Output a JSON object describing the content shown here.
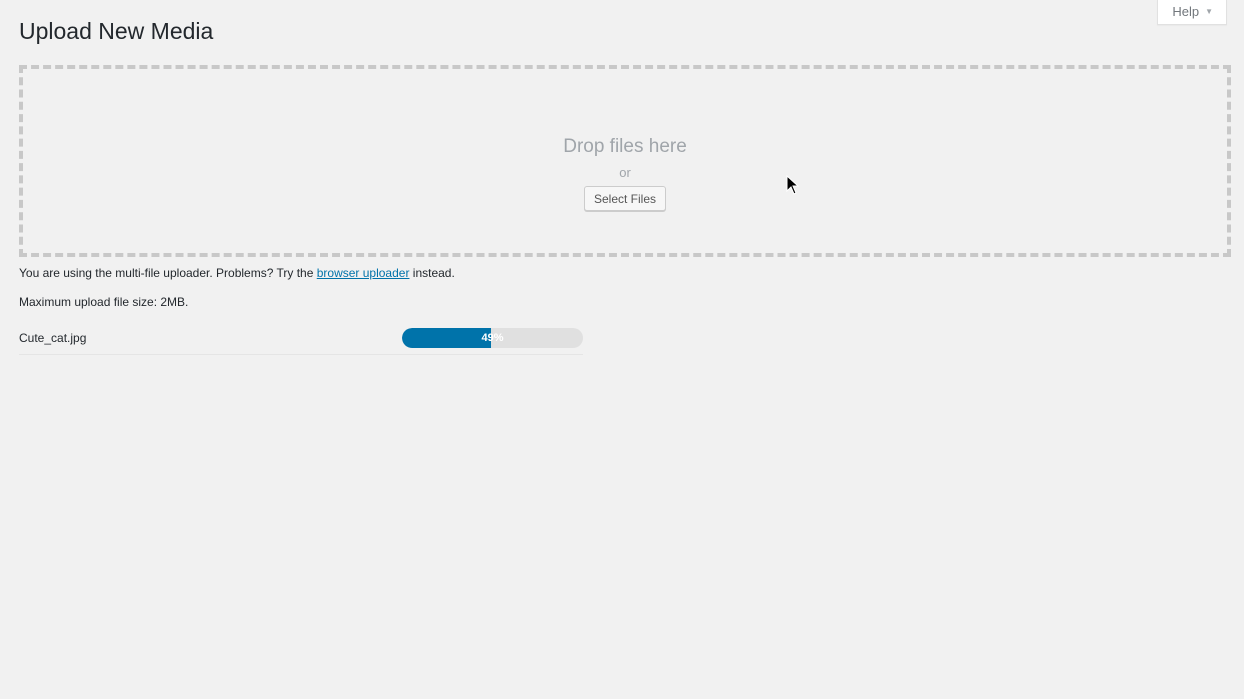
{
  "header": {
    "help_label": "Help",
    "title": "Upload New Media"
  },
  "drop_area": {
    "title": "Drop files here",
    "or_text": "or",
    "select_button": "Select Files"
  },
  "info": {
    "multi_uploader_prefix": "You are using the multi-file uploader. Problems? Try the ",
    "browser_uploader_link": "browser uploader",
    "multi_uploader_suffix": " instead.",
    "max_size": "Maximum upload file size: 2MB."
  },
  "uploads": [
    {
      "filename": "Cute_cat.jpg",
      "progress": 0.49,
      "progress_label": "49%"
    }
  ],
  "colors": {
    "accent": "#0073aa",
    "background": "#f1f1f1",
    "progress_track": "#e0e0e0"
  }
}
